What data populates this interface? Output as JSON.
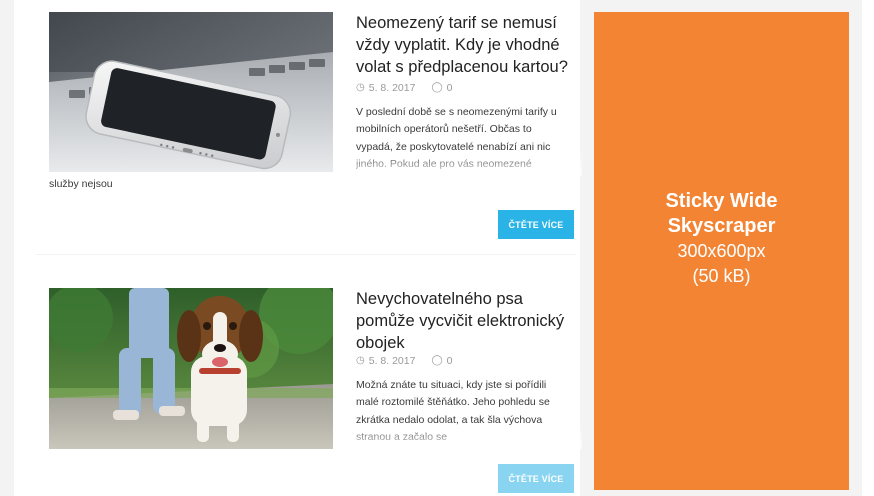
{
  "articles": [
    {
      "title_lines": [
        "Neomezený tarif se nemusí",
        "vždy vyplatit. Kdy je vhodné",
        "volat s předplacenou kartou?"
      ],
      "date": "5. 8. 2017",
      "comments": "0",
      "excerpt_lines": [
        "V poslední době se s neomezenými tarify u",
        "mobilních operátorů nešetří. Občas to",
        "vypadá, že poskytovatelé nenabízí ani nic",
        "jiného. Pokud ale pro vás neomezené"
      ],
      "excerpt_tail": "služby nejsou",
      "read_more": "ČTĚTE VÍCE",
      "thumb_icon": "smartphone-on-laptop-photo"
    },
    {
      "title_lines": [
        "Nevychovatelného psa",
        "pomůže vycvičit elektronický",
        "obojek"
      ],
      "date": "5. 8. 2017",
      "comments": "0",
      "excerpt_lines": [
        "Možná znáte tu situaci, kdy jste si pořídili",
        "malé roztomilé štěňátko. Jeho pohledu se",
        "zkrátka nedalo odolat, a tak šla výchova",
        "stranou a začalo se"
      ],
      "read_more": "ČTĚTE VÍCE",
      "thumb_icon": "beagle-dog-photo"
    }
  ],
  "icons": {
    "clock": "clock-icon",
    "comment": "comment-icon"
  },
  "ad": {
    "title_line1": "Sticky Wide",
    "title_line2": "Skyscraper",
    "size": "300x600px",
    "weight": "(50 kB)"
  },
  "colors": {
    "accent": "#29b3e6",
    "ad_background": "#f28433",
    "title": "#222222",
    "meta": "#9a9a9a"
  }
}
